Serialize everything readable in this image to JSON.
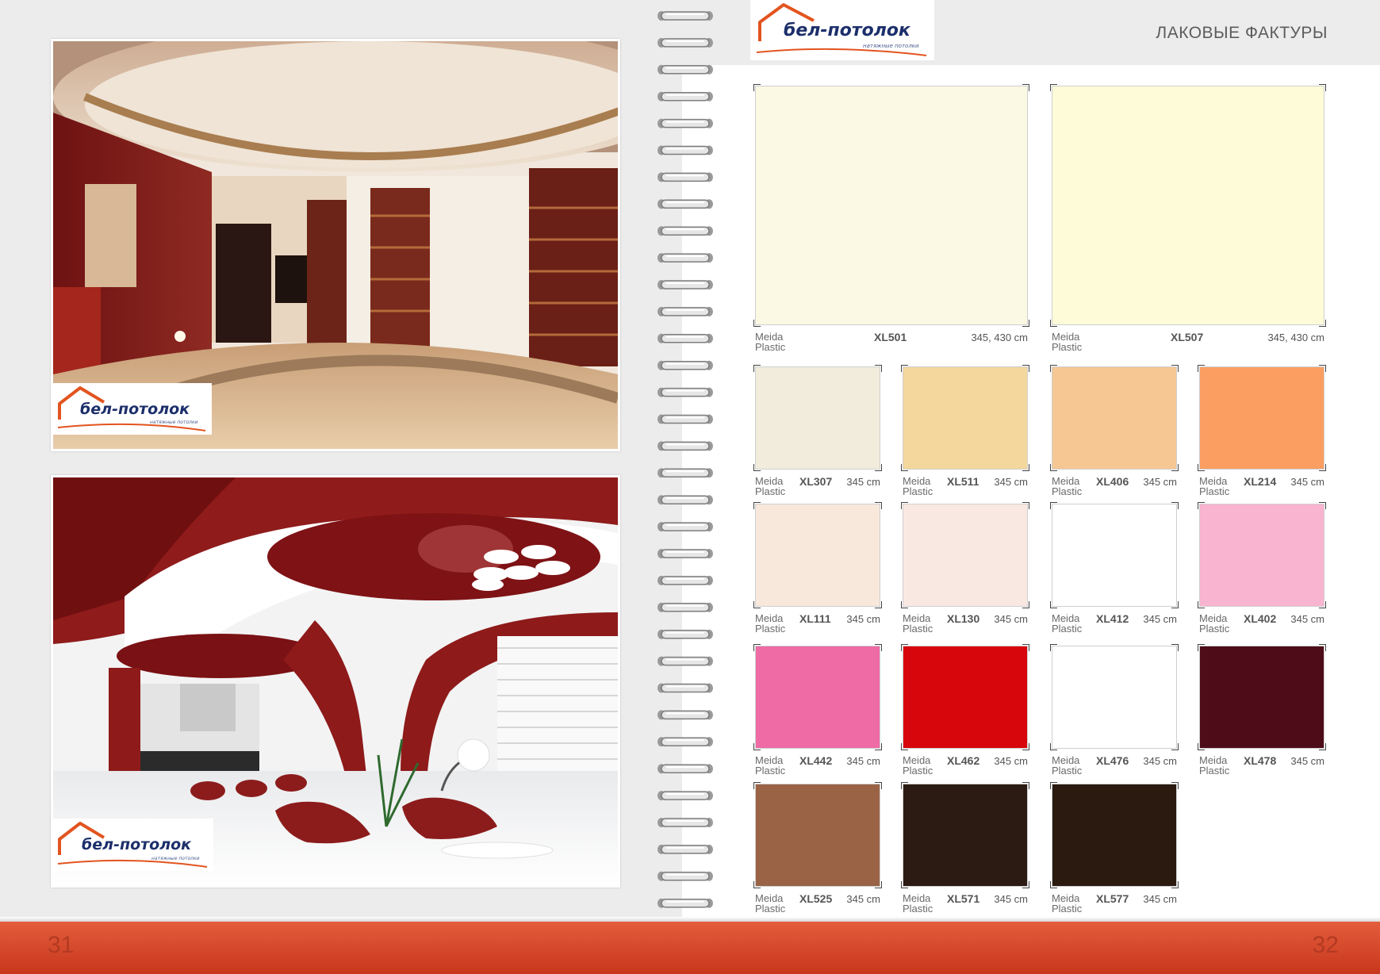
{
  "section_title": "ЛАКОВЫЕ ФАКТУРЫ",
  "page_numbers": {
    "left": "31",
    "right": "32"
  },
  "logo": {
    "name": "бел-потолок",
    "tagline": "натяжные потолки"
  },
  "brand_colors": {
    "logo_text": "#1c2f6b",
    "logo_swoosh": "#e2541f",
    "footer": "#d2432a"
  },
  "large_swatches": [
    {
      "maker_line1": "Meida",
      "maker_line2": "Plastic",
      "code": "XL501",
      "size": "345, 430 cm",
      "color": "#fbf8e4"
    },
    {
      "maker_line1": "Meida",
      "maker_line2": "Plastic",
      "code": "XL507",
      "size": "345, 430 cm",
      "color": "#fdfbd8"
    }
  ],
  "swatches": [
    {
      "maker_line1": "Meida",
      "maker_line2": "Plastic",
      "code": "XL307",
      "size": "345 cm",
      "color": "#f1ecdb"
    },
    {
      "maker_line1": "Meida",
      "maker_line2": "Plastic",
      "code": "XL511",
      "size": "345 cm",
      "color": "#f4d79c"
    },
    {
      "maker_line1": "Meida",
      "maker_line2": "Plastic",
      "code": "XL406",
      "size": "345 cm",
      "color": "#f6c693"
    },
    {
      "maker_line1": "Meida",
      "maker_line2": "Plastic",
      "code": "XL214",
      "size": "345 cm",
      "color": "#fb9e62"
    },
    {
      "maker_line1": "Meida",
      "maker_line2": "Plastic",
      "code": "XL111",
      "size": "345 cm",
      "color": "#f8e8dc"
    },
    {
      "maker_line1": "Meida",
      "maker_line2": "Plastic",
      "code": "XL130",
      "size": "345 cm",
      "color": "#f9e8e1"
    },
    {
      "maker_line1": "Meida",
      "maker_line2": "Plastic",
      "code": "XL412",
      "size": "345 cm",
      "color": "#ffffff"
    },
    {
      "maker_line1": "Meida",
      "maker_line2": "Plastic",
      "code": "XL402",
      "size": "345 cm",
      "color": "#f9b4cf"
    },
    {
      "maker_line1": "Meida",
      "maker_line2": "Plastic",
      "code": "XL442",
      "size": "345 cm",
      "color": "#ee6ba6"
    },
    {
      "maker_line1": "Meida",
      "maker_line2": "Plastic",
      "code": "XL462",
      "size": "345 cm",
      "color": "#d7060c"
    },
    {
      "maker_line1": "Meida",
      "maker_line2": "Plastic",
      "code": "XL476",
      "size": "345 cm",
      "color": "#ffffff"
    },
    {
      "maker_line1": "Meida",
      "maker_line2": "Plastic",
      "code": "XL478",
      "size": "345 cm",
      "color": "#4e0c18"
    },
    {
      "maker_line1": "Meida",
      "maker_line2": "Plastic",
      "code": "XL525",
      "size": "345 cm",
      "color": "#9a6346"
    },
    {
      "maker_line1": "Meida",
      "maker_line2": "Plastic",
      "code": "XL571",
      "size": "345 cm",
      "color": "#2c1b12"
    },
    {
      "maker_line1": "Meida",
      "maker_line2": "Plastic",
      "code": "XL577",
      "size": "345 cm",
      "color": "#2a1a10"
    }
  ]
}
